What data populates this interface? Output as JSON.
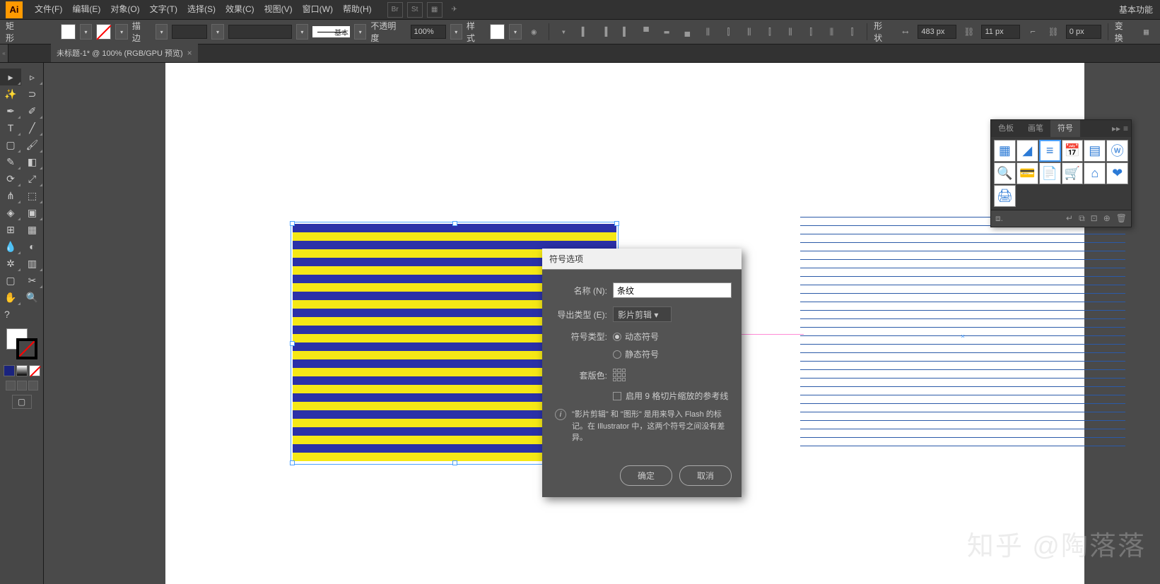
{
  "menubar": {
    "logo": "Ai",
    "items": [
      "文件(F)",
      "编辑(E)",
      "对象(O)",
      "文字(T)",
      "选择(S)",
      "效果(C)",
      "视图(V)",
      "窗口(W)",
      "帮助(H)"
    ],
    "right": "基本功能"
  },
  "controlbar": {
    "selection_label": "矩形",
    "stroke_label": "描边",
    "stroke_profile": "基本",
    "opacity_label": "不透明度",
    "opacity_value": "100%",
    "style_label": "样式",
    "shape_label": "形状",
    "width_value": "483 px",
    "height_value": "11 px",
    "corner_value": "0 px",
    "transform_label": "变换"
  },
  "tab": {
    "title": "未标题-1* @ 100% (RGB/GPU 预览)"
  },
  "dialog": {
    "title": "符号选项",
    "name_label": "名称 (N):",
    "name_value": "条纹",
    "export_label": "导出类型 (E):",
    "export_value": "影片剪辑",
    "type_label": "符号类型:",
    "type_dynamic": "动态符号",
    "type_static": "静态符号",
    "registration_label": "套版色:",
    "scale9_label": "启用 9 格切片缩放的参考线",
    "info_text": "\"影片剪辑\" 和 \"图形\" 是用来导入 Flash 的标记。在 Illustrator 中，这两个符号之间没有差异。",
    "ok": "确定",
    "cancel": "取消"
  },
  "symbols_panel": {
    "tabs": [
      "色板",
      "画笔",
      "符号"
    ],
    "active_tab": 2,
    "icons": [
      "▦",
      "◢",
      "≡",
      "📅",
      "▤",
      "ⓦ",
      "🔍",
      "💳",
      "📄",
      "🛒",
      "⌂",
      "❤",
      "🖨"
    ]
  },
  "watermark": "知乎 @陶落落"
}
